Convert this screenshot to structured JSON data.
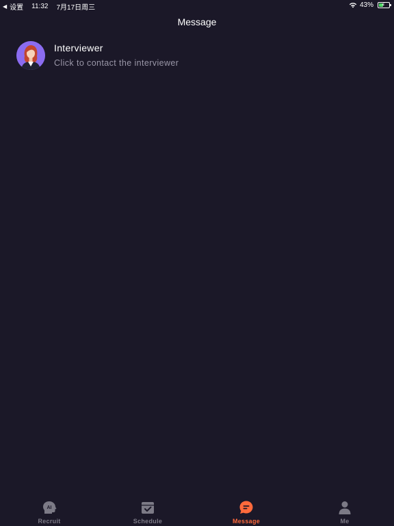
{
  "status_bar": {
    "back_label": "设置",
    "time": "11:32",
    "date": "7月17日周三",
    "battery_percent": "43%",
    "battery_level": 0.43
  },
  "header": {
    "title": "Message"
  },
  "contacts": [
    {
      "name": "Interviewer",
      "subtitle": "Click to contact the interviewer"
    }
  ],
  "tabs": [
    {
      "label": "Recruit",
      "icon": "ai-head-icon",
      "active": false
    },
    {
      "label": "Schedule",
      "icon": "calendar-check-icon",
      "active": false
    },
    {
      "label": "Message",
      "icon": "chat-bubble-icon",
      "active": true
    },
    {
      "label": "Me",
      "icon": "person-icon",
      "active": false
    }
  ],
  "colors": {
    "background": "#1b1828",
    "accent": "#ff6a3c",
    "inactive_tab": "#7c7a86",
    "subtitle": "#9a97a8",
    "avatar_bg": "#8b6cf0"
  }
}
